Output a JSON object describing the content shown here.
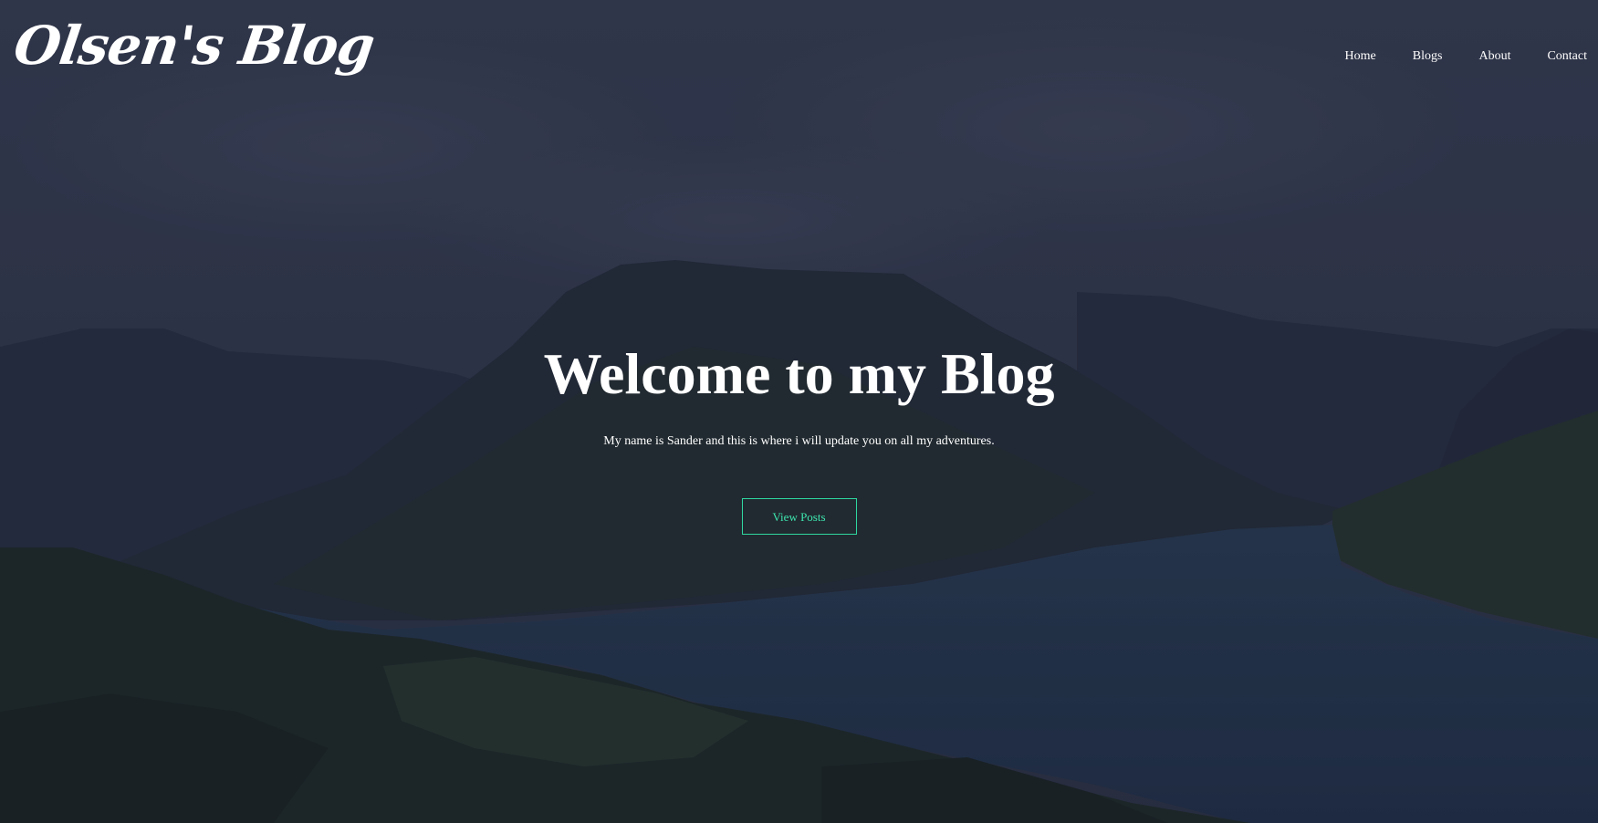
{
  "site": {
    "logo_text": "Olsen's Blog"
  },
  "nav": {
    "items": [
      {
        "label": "Home"
      },
      {
        "label": "Blogs"
      },
      {
        "label": "About"
      },
      {
        "label": "Contact"
      }
    ]
  },
  "hero": {
    "title": "Welcome to my Blog",
    "subtitle": "My name is Sander and this is where i will update you on all my adventures.",
    "cta_label": "View Posts",
    "background": "fjord-mountain-landscape"
  },
  "colors": {
    "accent": "#2fd7a0",
    "text": "#ffffff",
    "overlay": "#2b3244"
  }
}
